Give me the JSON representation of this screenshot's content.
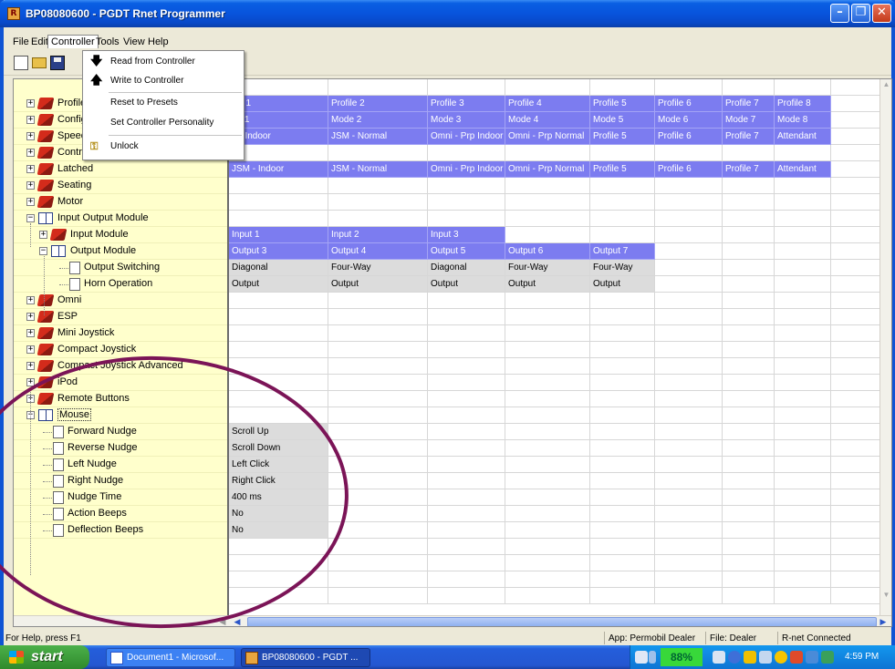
{
  "window": {
    "app_icon": "R",
    "title": "BP08080600 - PGDT Rnet Programmer",
    "minimize": "–",
    "maximize": "❐",
    "close": "✕"
  },
  "menubar": [
    "File",
    "Edit",
    "Controller",
    "Tools",
    "View",
    "Help"
  ],
  "controller_menu": [
    {
      "label": "Read from Controller",
      "icon": "down-arrow-icon"
    },
    {
      "label": "Write to Controller",
      "icon": "up-arrow-icon"
    },
    {
      "label": "Reset to Presets",
      "icon": ""
    },
    {
      "label": "Set Controller Personality",
      "icon": ""
    },
    {
      "label": "Unlock",
      "icon": "key-icon"
    }
  ],
  "tree": [
    {
      "label": "Profile",
      "indent": 0,
      "expander": "+",
      "icon": "closed-book"
    },
    {
      "label": "Config",
      "indent": 0,
      "expander": "+",
      "icon": "closed-book"
    },
    {
      "label": "Speed",
      "indent": 0,
      "expander": "+",
      "icon": "closed-book"
    },
    {
      "label": "Controls",
      "indent": 0,
      "expander": "+",
      "icon": "closed-book"
    },
    {
      "label": "Latched",
      "indent": 0,
      "expander": "+",
      "icon": "closed-book"
    },
    {
      "label": "Seating",
      "indent": 0,
      "expander": "+",
      "icon": "closed-book"
    },
    {
      "label": "Motor",
      "indent": 0,
      "expander": "+",
      "icon": "closed-book"
    },
    {
      "label": "Input Output Module",
      "indent": 0,
      "expander": "−",
      "icon": "open-book"
    },
    {
      "label": "Input Module",
      "indent": 1,
      "expander": "+",
      "icon": "closed-book"
    },
    {
      "label": "Output Module",
      "indent": 1,
      "expander": "−",
      "icon": "open-book"
    },
    {
      "label": "Output Switching",
      "indent": 2,
      "expander": "",
      "icon": "page"
    },
    {
      "label": "Horn Operation",
      "indent": 2,
      "expander": "",
      "icon": "page"
    },
    {
      "label": "Omni",
      "indent": 0,
      "expander": "+",
      "icon": "closed-book"
    },
    {
      "label": "ESP",
      "indent": 0,
      "expander": "+",
      "icon": "closed-book"
    },
    {
      "label": "Mini Joystick",
      "indent": 0,
      "expander": "+",
      "icon": "closed-book"
    },
    {
      "label": "Compact Joystick",
      "indent": 0,
      "expander": "+",
      "icon": "closed-book"
    },
    {
      "label": "Compact Joystick Advanced",
      "indent": 0,
      "expander": "+",
      "icon": "closed-book"
    },
    {
      "label": "iPod",
      "indent": 0,
      "expander": "+",
      "icon": "closed-book"
    },
    {
      "label": "Remote Buttons",
      "indent": 0,
      "expander": "+",
      "icon": "closed-book"
    },
    {
      "label": "Mouse",
      "indent": 0,
      "expander": "−",
      "icon": "open-book",
      "selected": true
    },
    {
      "label": "Forward Nudge",
      "indent": 1,
      "expander": "",
      "icon": "page"
    },
    {
      "label": "Reverse Nudge",
      "indent": 1,
      "expander": "",
      "icon": "page"
    },
    {
      "label": "Left Nudge",
      "indent": 1,
      "expander": "",
      "icon": "page"
    },
    {
      "label": "Right Nudge",
      "indent": 1,
      "expander": "",
      "icon": "page"
    },
    {
      "label": "Nudge Time",
      "indent": 1,
      "expander": "",
      "icon": "page"
    },
    {
      "label": "Action Beeps",
      "indent": 1,
      "expander": "",
      "icon": "page"
    },
    {
      "label": "Deflection Beeps",
      "indent": 1,
      "expander": "",
      "icon": "page"
    }
  ],
  "grid_rows": [
    {
      "style": "blue",
      "cells": [
        "file 1",
        "Profile 2",
        "Profile 3",
        "Profile 4",
        "Profile 5",
        "Profile 6",
        "Profile 7",
        "Profile 8"
      ]
    },
    {
      "style": "blue",
      "cells": [
        "de 1",
        "Mode 2",
        "Mode 3",
        "Mode 4",
        "Mode 5",
        "Mode 6",
        "Mode 7",
        "Mode 8"
      ]
    },
    {
      "style": "blue",
      "cells": [
        "/I - Indoor",
        "JSM - Normal",
        "Omni - Prp Indoor",
        "Omni - Prp Normal",
        "Profile 5",
        "Profile 6",
        "Profile 7",
        "Attendant"
      ]
    },
    {
      "style": "none",
      "cells": []
    },
    {
      "style": "blue",
      "cells": [
        "JSM - Indoor",
        "JSM - Normal",
        "Omni - Prp Indoor",
        "Omni - Prp Normal",
        "Profile 5",
        "Profile 6",
        "Profile 7",
        "Attendant"
      ]
    },
    {
      "style": "none",
      "cells": []
    },
    {
      "style": "none",
      "cells": []
    },
    {
      "style": "none",
      "cells": []
    },
    {
      "style": "blue",
      "cells": [
        "Input 1",
        "Input 2",
        "Input 3"
      ]
    },
    {
      "style": "blue",
      "cells": [
        "Output 3",
        "Output 4",
        "Output 5",
        "Output 6",
        "Output 7"
      ]
    },
    {
      "style": "gray",
      "cells": [
        "Diagonal",
        "Four-Way",
        "Diagonal",
        "Four-Way",
        "Four-Way"
      ]
    },
    {
      "style": "gray",
      "cells": [
        "Output",
        "Output",
        "Output",
        "Output",
        "Output"
      ]
    },
    {
      "style": "none",
      "cells": []
    },
    {
      "style": "none",
      "cells": []
    },
    {
      "style": "none",
      "cells": []
    },
    {
      "style": "none",
      "cells": []
    },
    {
      "style": "none",
      "cells": []
    },
    {
      "style": "none",
      "cells": []
    },
    {
      "style": "none",
      "cells": []
    },
    {
      "style": "none",
      "cells": []
    },
    {
      "style": "gray",
      "cells": [
        "Scroll Up"
      ]
    },
    {
      "style": "gray",
      "cells": [
        "Scroll Down"
      ]
    },
    {
      "style": "gray",
      "cells": [
        "Left Click"
      ]
    },
    {
      "style": "gray",
      "cells": [
        "Right Click"
      ]
    },
    {
      "style": "gray",
      "cells": [
        "400 ms"
      ]
    },
    {
      "style": "gray",
      "cells": [
        "No"
      ]
    },
    {
      "style": "gray",
      "cells": [
        "No"
      ]
    }
  ],
  "statusbar": {
    "help": "For Help, press F1",
    "app": "App: Permobil Dealer",
    "file": "File: Dealer",
    "connection": "R-net Connected"
  },
  "taskbar": {
    "start": "start",
    "tasks": [
      "Document1 - Microsof...",
      "BP08080600 - PGDT ..."
    ],
    "battery": "88%",
    "clock": "4:59 PM"
  },
  "colors": {
    "title_blue": "#0854dc",
    "tree_bg": "#ffffcc",
    "grid_blue": "#7c7cf0",
    "grid_gray": "#dcdcdc",
    "annotation": "#7b1457"
  }
}
